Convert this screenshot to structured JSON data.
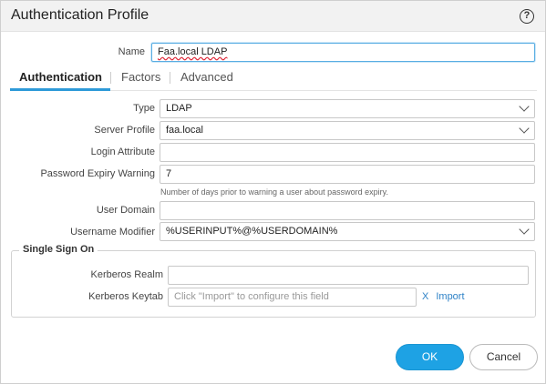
{
  "window": {
    "title": "Authentication Profile",
    "help_icon_glyph": "?"
  },
  "name_field": {
    "label": "Name",
    "value": "Faa.local LDAP"
  },
  "tabs": [
    {
      "label": "Authentication",
      "active": true
    },
    {
      "label": "Factors",
      "active": false
    },
    {
      "label": "Advanced",
      "active": false
    }
  ],
  "form": {
    "type": {
      "label": "Type",
      "value": "LDAP"
    },
    "server_profile": {
      "label": "Server Profile",
      "value": "faa.local"
    },
    "login_attribute": {
      "label": "Login Attribute",
      "value": ""
    },
    "password_expiry_warning": {
      "label": "Password Expiry Warning",
      "value": "7",
      "hint": "Number of days prior to warning a user about password expiry."
    },
    "user_domain": {
      "label": "User Domain",
      "value": ""
    },
    "username_modifier": {
      "label": "Username Modifier",
      "value": "%USERINPUT%@%USERDOMAIN%"
    }
  },
  "sso": {
    "legend": "Single Sign On",
    "kerberos_realm": {
      "label": "Kerberos Realm",
      "value": ""
    },
    "kerberos_keytab": {
      "label": "Kerberos Keytab",
      "placeholder": "Click \"Import\" to configure this field"
    },
    "import_x": "X",
    "import_label": "Import"
  },
  "buttons": {
    "ok": "OK",
    "cancel": "Cancel"
  },
  "colors": {
    "accent": "#1ea2e4",
    "link": "#2e82c7",
    "tab_underline": "#2e9ad8"
  }
}
